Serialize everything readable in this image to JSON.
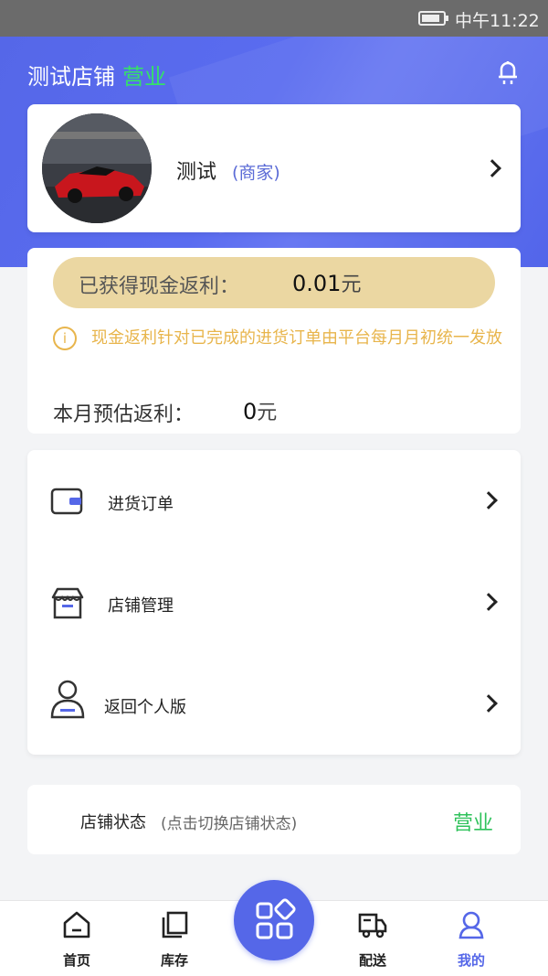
{
  "status_bar": {
    "time": "中午11:22",
    "battery_level": 0.85
  },
  "header": {
    "shop_name": "测试店铺",
    "shop_status": "营业"
  },
  "profile": {
    "name": "测试",
    "role": "(商家)"
  },
  "rebate": {
    "earned_label": "已获得现金返利：",
    "earned_value": "0.01",
    "earned_unit": "元",
    "note": "现金返利针对已完成的进货订单由平台每月月初统一发放",
    "monthly_label": "本月预估返利：",
    "monthly_value": "0",
    "monthly_unit": "元"
  },
  "menu": {
    "items": [
      {
        "label": "进货订单",
        "icon": "wallet-icon"
      },
      {
        "label": "店铺管理",
        "icon": "store-icon"
      },
      {
        "label": "返回个人版",
        "icon": "user-icon"
      }
    ]
  },
  "shop_status_card": {
    "label": "店铺状态",
    "hint": "(点击切换店铺状态)",
    "value": "营业"
  },
  "bottom_nav": {
    "items": [
      {
        "label": "首页",
        "icon": "home-icon"
      },
      {
        "label": "库存",
        "icon": "inventory-icon"
      },
      {
        "label": "配送",
        "icon": "truck-icon"
      },
      {
        "label": "我的",
        "icon": "profile-icon"
      }
    ],
    "active": "我的",
    "center_icon": "apps-grid-icon"
  },
  "colors": {
    "accent": "#5567e8",
    "status_green": "#2fc25b",
    "gold_pill": "#ebd7a2",
    "note": "#e8b54c"
  }
}
